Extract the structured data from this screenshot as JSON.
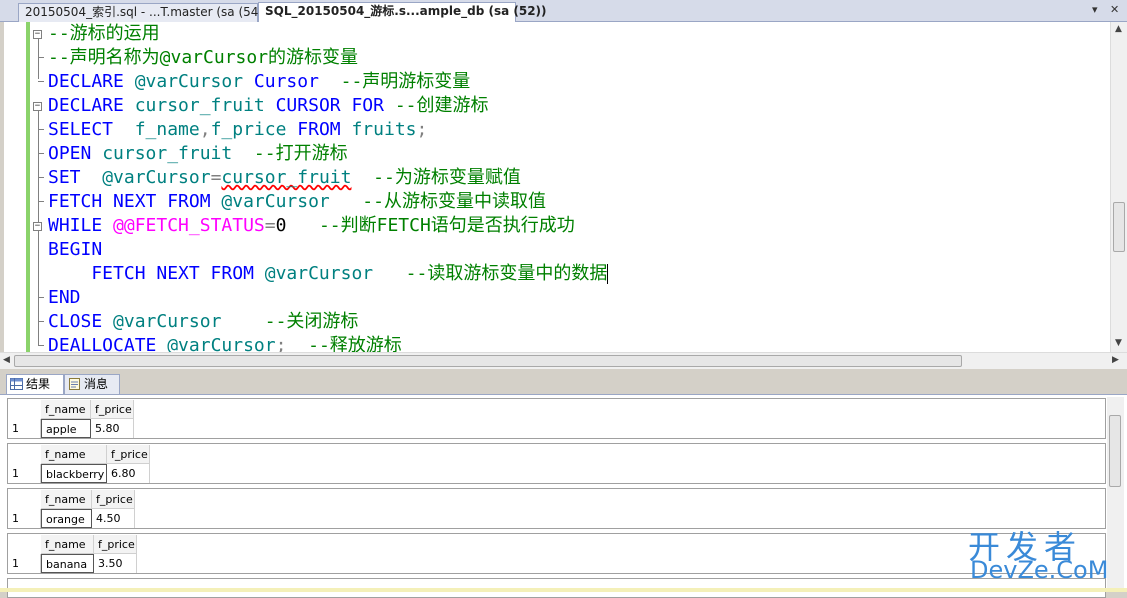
{
  "tabs": {
    "inactive_label": "20150504_索引.sql - ...T.master (sa (54))",
    "active_label": "SQL_20150504_游标.s...ample_db (sa (52))",
    "dropdown_glyph": "▾",
    "close_glyph": "✕"
  },
  "editor": {
    "lines": [
      [
        {
          "c": "cm",
          "t": "--游标的运用"
        }
      ],
      [
        {
          "c": "cm",
          "t": "--声明名称为@varCursor的游标变量"
        }
      ],
      [
        {
          "c": "kw",
          "t": "DECLARE "
        },
        {
          "c": "var",
          "t": "@varCursor "
        },
        {
          "c": "kw",
          "t": "Cursor  "
        },
        {
          "c": "cm",
          "t": "--声明游标变量"
        }
      ],
      [
        {
          "c": "kw",
          "t": "DECLARE "
        },
        {
          "c": "var",
          "t": "cursor_fruit "
        },
        {
          "c": "kw",
          "t": "CURSOR FOR "
        },
        {
          "c": "cm",
          "t": "--创建游标"
        }
      ],
      [
        {
          "c": "kw",
          "t": "SELECT  "
        },
        {
          "c": "var",
          "t": "f_name"
        },
        {
          "c": "gray",
          "t": ","
        },
        {
          "c": "var",
          "t": "f_price "
        },
        {
          "c": "kw",
          "t": "FROM "
        },
        {
          "c": "var",
          "t": "fruits"
        },
        {
          "c": "gray",
          "t": ";"
        }
      ],
      [
        {
          "c": "kw",
          "t": "OPEN "
        },
        {
          "c": "var",
          "t": "cursor_fruit  "
        },
        {
          "c": "cm",
          "t": "--打开游标"
        }
      ],
      [
        {
          "c": "kw",
          "t": "SET  "
        },
        {
          "c": "var",
          "t": "@varCursor"
        },
        {
          "c": "gray",
          "t": "="
        },
        {
          "c": "var squig",
          "t": "cursor_fruit"
        },
        {
          "c": "plain",
          "t": "  "
        },
        {
          "c": "cm",
          "t": "--为游标变量赋值"
        }
      ],
      [
        {
          "c": "kw",
          "t": "FETCH NEXT FROM "
        },
        {
          "c": "var",
          "t": "@varCursor   "
        },
        {
          "c": "cm",
          "t": "--从游标变量中读取值"
        }
      ],
      [
        {
          "c": "kw",
          "t": "WHILE "
        },
        {
          "c": "sys",
          "t": "@@FETCH_STATUS"
        },
        {
          "c": "gray",
          "t": "="
        },
        {
          "c": "plain",
          "t": "0   "
        },
        {
          "c": "cm",
          "t": "--判断FETCH语句是否执行成功"
        }
      ],
      [
        {
          "c": "kw",
          "t": "BEGIN"
        }
      ],
      [
        {
          "c": "kw",
          "t": "    FETCH NEXT FROM "
        },
        {
          "c": "var",
          "t": "@varCursor   "
        },
        {
          "c": "cm",
          "t": "--读取游标变量中的数据"
        }
      ],
      [
        {
          "c": "kw",
          "t": "END"
        }
      ],
      [
        {
          "c": "kw",
          "t": "CLOSE "
        },
        {
          "c": "var",
          "t": "@varCursor    "
        },
        {
          "c": "cm",
          "t": "--关闭游标"
        }
      ],
      [
        {
          "c": "kw",
          "t": "DEALLOCATE "
        },
        {
          "c": "var",
          "t": "@varCursor"
        },
        {
          "c": "gray",
          "t": ";  "
        },
        {
          "c": "cm",
          "t": "--释放游标"
        }
      ]
    ]
  },
  "results_tabs": {
    "results_label": "结果",
    "messages_label": "消息"
  },
  "result_grids": [
    {
      "columns": [
        "f_name",
        "f_price"
      ],
      "row_number": "1",
      "values": [
        "apple",
        "5.80"
      ]
    },
    {
      "columns": [
        "f_name",
        "f_price"
      ],
      "row_number": "1",
      "values": [
        "blackberry",
        "6.80"
      ]
    },
    {
      "columns": [
        "f_name",
        "f_price"
      ],
      "row_number": "1",
      "values": [
        "orange",
        "4.50"
      ]
    },
    {
      "columns": [
        "f_name",
        "f_price"
      ],
      "row_number": "1",
      "values": [
        "banana",
        "3.50"
      ]
    }
  ],
  "watermark": {
    "line1": "开发者",
    "line2": "DevZe.CoM"
  }
}
